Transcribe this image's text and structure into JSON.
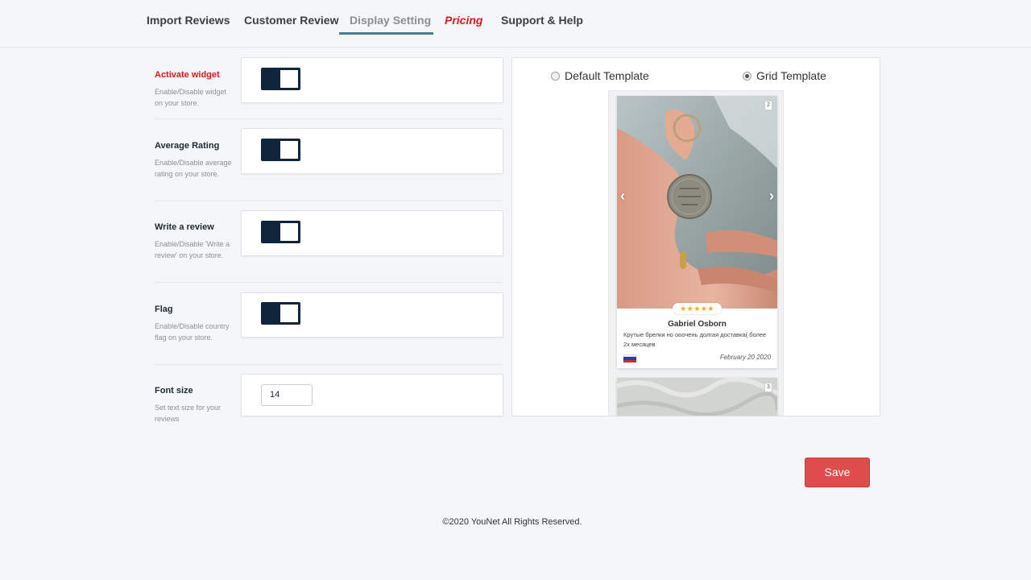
{
  "tabs": [
    {
      "label": "Import Reviews"
    },
    {
      "label": "Customer Review"
    },
    {
      "label": "Display Setting",
      "active": true
    },
    {
      "label": "Pricing"
    },
    {
      "label": "Support & Help"
    }
  ],
  "settings": {
    "activate_widget": {
      "title": "Activate widget",
      "desc": "Enable/Disable widget on your store.",
      "enabled": true
    },
    "average_rating": {
      "title": "Average Rating",
      "desc": "Enable/Disable average rating on your store.",
      "enabled": true
    },
    "write_review": {
      "title": "Write a review",
      "desc": "Enable/Disable 'Write a review' on your store.",
      "enabled": true
    },
    "flag": {
      "title": "Flag",
      "desc": "Enable/Disable country flag on your store.",
      "enabled": true
    },
    "font_size": {
      "title": "Font size",
      "desc": "Set text size for your reviews",
      "value": "14"
    }
  },
  "preview": {
    "default_template_label": "Default Template",
    "grid_template_label": "Grid Template",
    "selected_template": "Grid Template",
    "review": {
      "image_count": "2",
      "stars": "★★★★★",
      "rating": 5,
      "name": "Gabriel Osborn",
      "text": "Крутые брелки но ооочень долгая доставка( более 2х месяцев",
      "date": "February 20 2020",
      "flag_country": "Russia"
    },
    "review2": {
      "image_count": "3"
    },
    "arrow_prev": "‹",
    "arrow_next": "›"
  },
  "save_label": "Save",
  "footer": "©2020 YouNet All Rights Reserved.",
  "colors": {
    "accent_red": "#e0161b",
    "toggle_dark": "#10243b",
    "save_button": "#de4d4a",
    "tab_underline": "#4a7d93",
    "star": "#f5a623"
  }
}
